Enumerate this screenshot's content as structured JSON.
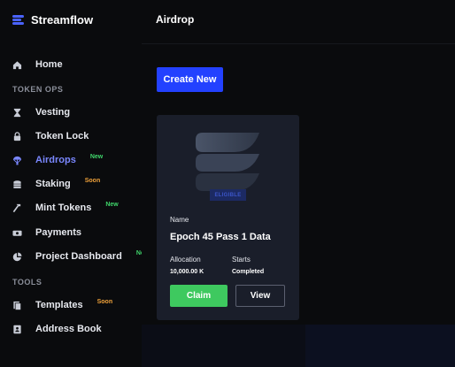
{
  "brand": {
    "name": "Streamflow",
    "icon": "streamflow-logo-icon",
    "accent": "#4a63ff"
  },
  "header": {
    "title": "Airdrop"
  },
  "sidebar": {
    "home": {
      "label": "Home",
      "icon": "home-icon"
    },
    "section_token_ops": "TOKEN OPS",
    "items": [
      {
        "label": "Vesting",
        "icon": "hourglass-icon",
        "badge": ""
      },
      {
        "label": "Token Lock",
        "icon": "lock-icon",
        "badge": ""
      },
      {
        "label": "Airdrops",
        "icon": "parachute-icon",
        "badge": "New",
        "active": true
      },
      {
        "label": "Staking",
        "icon": "coins-icon",
        "badge": "Soon"
      },
      {
        "label": "Mint Tokens",
        "icon": "hammer-icon",
        "badge": "New"
      },
      {
        "label": "Payments",
        "icon": "cash-icon",
        "badge": ""
      },
      {
        "label": "Project Dashboard",
        "icon": "pie-chart-icon",
        "badge": "New"
      }
    ],
    "section_tools": "TOOLS",
    "tools": [
      {
        "label": "Templates",
        "icon": "templates-icon",
        "badge": "Soon"
      },
      {
        "label": "Address Book",
        "icon": "address-book-icon",
        "badge": ""
      }
    ]
  },
  "main": {
    "create_button": "Create New",
    "card": {
      "badge": "ELIGIBLE",
      "name_label": "Name",
      "name_value": "Epoch 45 Pass 1 Data",
      "allocation_label": "Allocation",
      "allocation_value": "10,000.00 K",
      "starts_label": "Starts",
      "starts_value": "Completed",
      "claim_button": "Claim",
      "view_button": "View"
    }
  },
  "colors": {
    "primary_button": "#2341ff",
    "claim_button": "#3ec95f",
    "badge_new": "#3fd46a",
    "badge_soon": "#f0a23a",
    "active_nav": "#7a87ff"
  }
}
